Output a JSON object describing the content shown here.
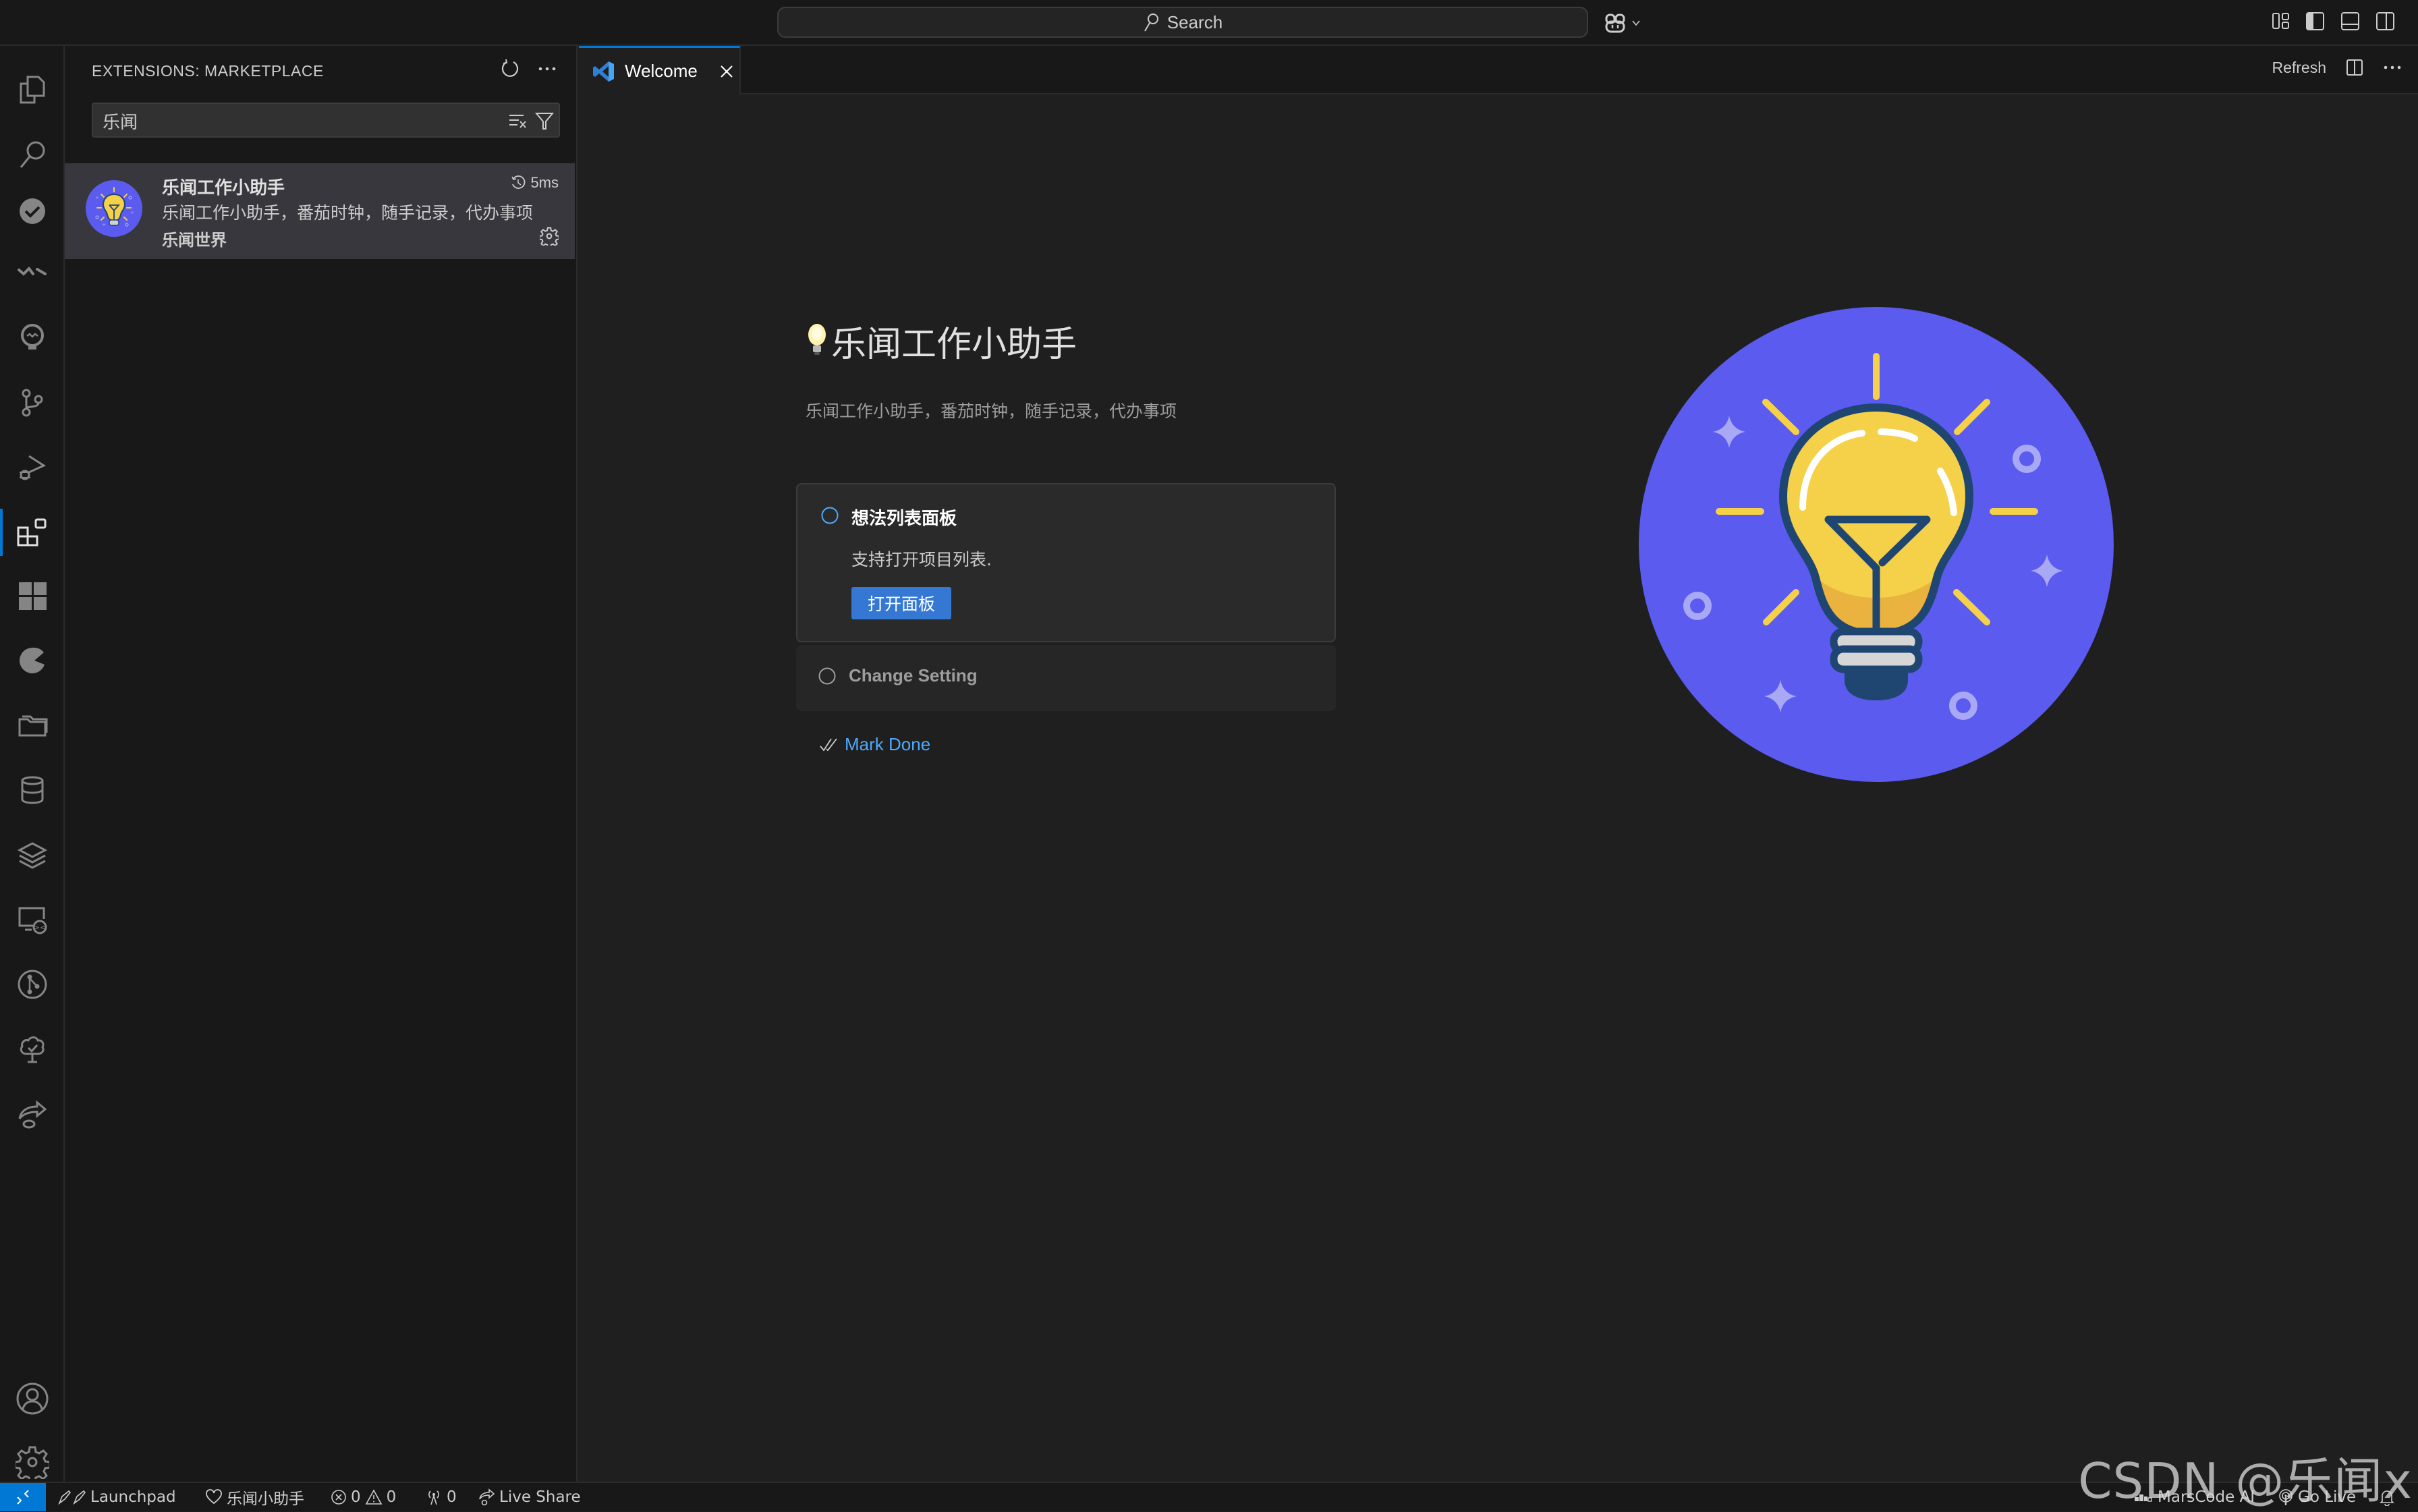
{
  "titlebar": {
    "search_label": "Search",
    "layout_controls": [
      "customize-layout",
      "toggle-primary-sidebar",
      "toggle-panel",
      "toggle-secondary-sidebar"
    ]
  },
  "activity_bar": {
    "items": [
      {
        "name": "explorer",
        "icon": "files-icon"
      },
      {
        "name": "search",
        "icon": "search-icon"
      },
      {
        "name": "todo",
        "icon": "check-circle-icon"
      },
      {
        "name": "marscode",
        "icon": "marscode-icon"
      },
      {
        "name": "lightbulb",
        "icon": "lightbulb-icon"
      },
      {
        "name": "source-control",
        "icon": "source-control-icon"
      },
      {
        "name": "run-debug",
        "icon": "run-debug-icon"
      },
      {
        "name": "extensions",
        "icon": "extensions-icon",
        "active": true
      },
      {
        "name": "grid",
        "icon": "grid-icon"
      },
      {
        "name": "pie",
        "icon": "pie-icon"
      },
      {
        "name": "folders",
        "icon": "folders-icon"
      },
      {
        "name": "database",
        "icon": "database-icon"
      },
      {
        "name": "layers",
        "icon": "layers-icon"
      },
      {
        "name": "remote-explorer",
        "icon": "remote-explorer-icon"
      },
      {
        "name": "git-graph",
        "icon": "git-graph-icon"
      },
      {
        "name": "tree-check",
        "icon": "tree-check-icon"
      },
      {
        "name": "live-share",
        "icon": "live-share-icon"
      }
    ],
    "bottom": [
      {
        "name": "accounts",
        "icon": "account-icon"
      },
      {
        "name": "manage",
        "icon": "gear-icon"
      }
    ]
  },
  "sidebar": {
    "title": "EXTENSIONS: MARKETPLACE",
    "search_value": "乐闻",
    "results": [
      {
        "name": "乐闻工作小助手",
        "description": "乐闻工作小助手，番茄时钟，随手记录，代办事项",
        "publisher": "乐闻世界",
        "activation_time": "5ms"
      }
    ]
  },
  "editor": {
    "tabs": [
      {
        "label": "Welcome",
        "active": true
      }
    ],
    "actions": {
      "refresh_label": "Refresh"
    },
    "walkthrough": {
      "title": "乐闻工作小助手",
      "subtitle": "乐闻工作小助手，番茄时钟，随手记录，代办事项",
      "steps": [
        {
          "title": "想法列表面板",
          "description": "支持打开项目列表.",
          "button_label": "打开面板",
          "expanded": true
        },
        {
          "title": "Change Setting",
          "expanded": false
        }
      ],
      "mark_done_label": "Mark Done"
    },
    "illustration": {
      "background_color": "#5b5bef",
      "bulb_color": "#f5d14a",
      "outline_color": "#1f4571"
    }
  },
  "statusbar": {
    "launchpad_label": "Launchpad",
    "extension_label": "乐闻小助手",
    "errors": "0",
    "warnings": "0",
    "ports": "0",
    "live_share_label": "Live Share",
    "marscode_label": "MarsCode AI",
    "go_live_label": "Go Live"
  },
  "watermark": "CSDN @乐闻x",
  "colors": {
    "accent": "#0078d4",
    "button": "#3478d4",
    "link": "#4daafc"
  }
}
